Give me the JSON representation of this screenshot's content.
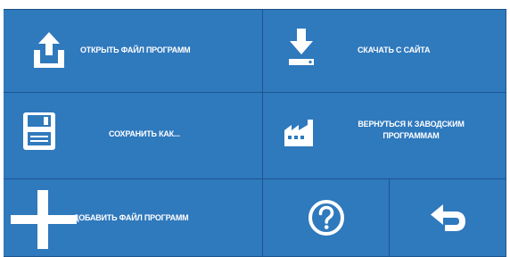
{
  "menu": {
    "open_program_file": "ОТКРЫТЬ ФАЙЛ ПРОГРАММ",
    "download_from_site": "СКАЧАТЬ С САЙТА",
    "save_as": "СОХРАНИТЬ КАК...",
    "factory_reset_line1": "ВЕРНУТЬСЯ К ЗАВОДСКИМ",
    "factory_reset_line2": "ПРОГРАММАМ",
    "add_program_file": "ДОБАВИТЬ ФАЙЛ ПРОГРАММ"
  },
  "icons": {
    "upload": "upload-icon",
    "download": "download-icon",
    "save": "floppy-disk-icon",
    "factory": "factory-icon",
    "add": "plus-icon",
    "help": "question-mark-icon",
    "back": "return-arrow-icon"
  },
  "colors": {
    "tile": "#2f79bd",
    "border": "#1d5690",
    "icon": "#ffffff"
  }
}
